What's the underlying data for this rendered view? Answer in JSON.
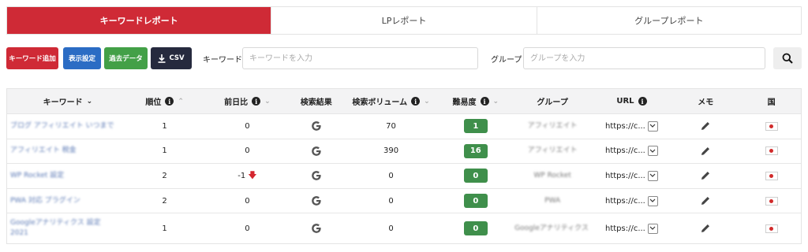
{
  "tabs": [
    {
      "label": "キーワードレポート",
      "active": true
    },
    {
      "label": "LPレポート",
      "active": false
    },
    {
      "label": "グループレポート",
      "active": false
    }
  ],
  "toolbar": {
    "add_keyword": "キーワード追加",
    "display_settings": "表示設定",
    "past_data": "過去データ",
    "csv": "CSV",
    "keyword_label": "キーワード",
    "keyword_placeholder": "キーワードを入力",
    "group_label": "グループ",
    "group_placeholder": "グループを入力"
  },
  "table": {
    "headers": {
      "keyword": "キーワード",
      "rank": "順位",
      "diff": "前日比",
      "serp": "検索結果",
      "volume": "検索ボリューム",
      "difficulty": "難易度",
      "group": "グループ",
      "url": "URL",
      "memo": "メモ",
      "country": "国"
    },
    "rows": [
      {
        "keyword": "ブログ アフィリエイト いつまで",
        "rank": "1",
        "diff": "0",
        "volume": "70",
        "difficulty": "1",
        "group": "アフィリエイト",
        "url": "https://c..."
      },
      {
        "keyword": "アフィリエイト 税金",
        "rank": "1",
        "diff": "0",
        "volume": "390",
        "difficulty": "16",
        "group": "アフィリエイト",
        "url": "https://c..."
      },
      {
        "keyword": "WP Rocket 設定",
        "rank": "2",
        "diff": "-1",
        "volume": "0",
        "difficulty": "0",
        "group": "WP Rocket",
        "url": "https://c..."
      },
      {
        "keyword": "PWA 対応 プラグイン",
        "rank": "2",
        "diff": "0",
        "volume": "0",
        "difficulty": "0",
        "group": "PWA",
        "url": "https://c..."
      },
      {
        "keyword": "Googleアナリティクス 設定 2021",
        "rank": "1",
        "diff": "0",
        "volume": "0",
        "difficulty": "0",
        "group": "Googleアナリティクス",
        "url": "https://c..."
      }
    ]
  },
  "colors": {
    "brand_red": "#cf2a36",
    "button_blue": "#2b6cc4",
    "button_green": "#43a047",
    "button_dark": "#262a3e",
    "badge_green": "#3f8f4b"
  }
}
